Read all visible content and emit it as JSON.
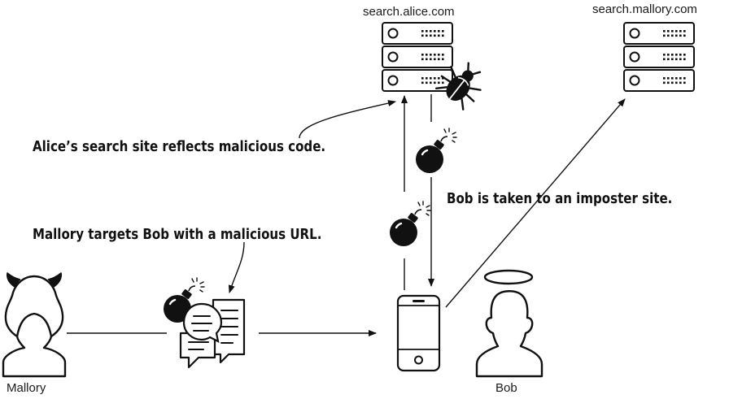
{
  "servers": {
    "alice": {
      "label": "search.alice.com"
    },
    "mallory": {
      "label": "search.mallory.com"
    }
  },
  "people": {
    "mallory": {
      "label": "Mallory"
    },
    "bob": {
      "label": "Bob"
    }
  },
  "callouts": {
    "alice_reflects": "Alice’s search site reflects malicious code.",
    "mallory_targets": "Mallory targets Bob with a malicious URL.",
    "imposter": "Bob is taken to an imposter site."
  },
  "icons": {
    "server": "server-stack-icon",
    "bug": "bug-icon",
    "bomb": "bomb-icon",
    "chat": "chat-bubbles-icon",
    "phone": "smartphone-icon",
    "devil": "devil-horns-icon",
    "halo": "halo-icon"
  },
  "colors": {
    "ink": "#111111",
    "paper": "#ffffff"
  }
}
